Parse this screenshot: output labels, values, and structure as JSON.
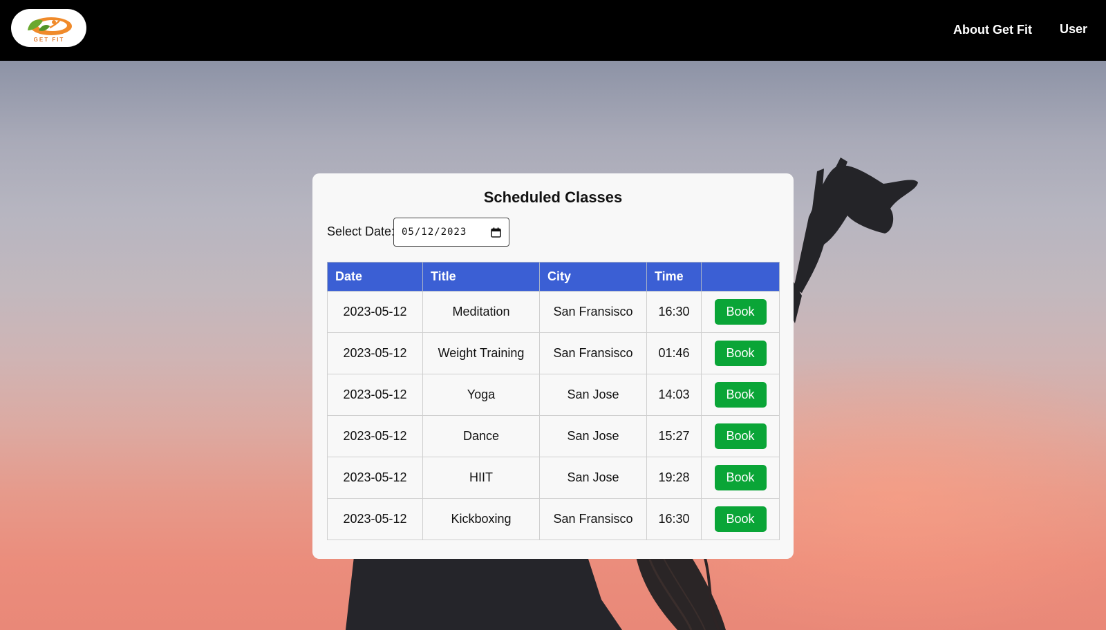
{
  "navbar": {
    "logo_text": "GET FIT",
    "about_label": "About Get Fit",
    "user_label": "User"
  },
  "card": {
    "title": "Scheduled Classes",
    "date_label": "Select Date:",
    "date_value": "05/12/2023"
  },
  "table": {
    "headers": [
      "Date",
      "Title",
      "City",
      "Time",
      ""
    ],
    "book_label": "Book",
    "rows": [
      {
        "date": "2023-05-12",
        "title": "Meditation",
        "city": "San Fransisco",
        "time": "16:30"
      },
      {
        "date": "2023-05-12",
        "title": "Weight Training",
        "city": "San Fransisco",
        "time": "01:46"
      },
      {
        "date": "2023-05-12",
        "title": "Yoga",
        "city": "San Jose",
        "time": "14:03"
      },
      {
        "date": "2023-05-12",
        "title": "Dance",
        "city": "San Jose",
        "time": "15:27"
      },
      {
        "date": "2023-05-12",
        "title": "HIIT",
        "city": "San Jose",
        "time": "19:28"
      },
      {
        "date": "2023-05-12",
        "title": "Kickboxing",
        "city": "San Fransisco",
        "time": "16:30"
      }
    ]
  },
  "colors": {
    "navbar": "#000000",
    "table_header": "#3b5fd4",
    "book_button": "#0aa537",
    "card": "#f8f8f8"
  }
}
